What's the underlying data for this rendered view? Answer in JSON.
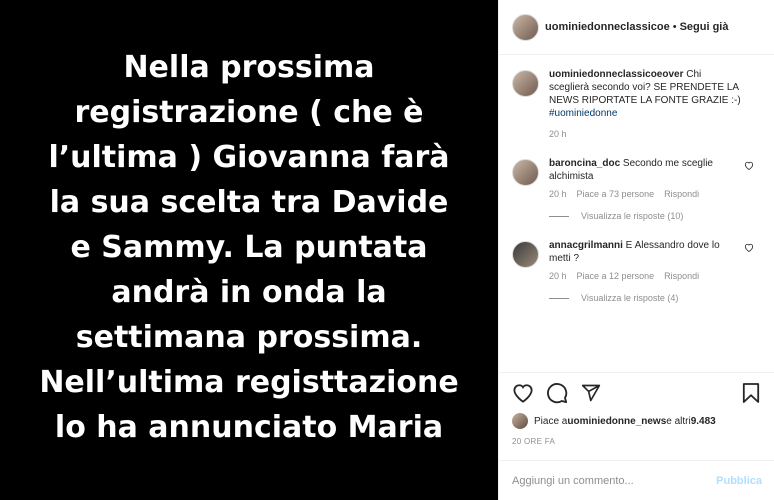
{
  "post": {
    "image_text": "Nella prossima\nregistrazione ( che è\nl’ultima ) Giovanna farà\nla sua scelta tra Davide\ne Sammy. La puntata\nandrà in onda la\nsettimana prossima.\nNell’ultima registtazione\nlo ha annunciato Maria"
  },
  "header": {
    "username": "uominiedonneclassicoe",
    "separator": "•",
    "follow_label": "Segui già"
  },
  "caption": {
    "username": "uominiedonneclassicoeover",
    "text": " Chi sceglierà secondo voi? SE PRENDETE LA NEWS RIPORTATE LA FONTE GRAZIE :-) ",
    "hashtag": "#uominiedonne",
    "time": "20 h"
  },
  "comments": [
    {
      "username": "baroncina_doc",
      "text": " Secondo me sceglie alchimista",
      "time": "20 h",
      "likes": "Piace a 73 persone",
      "reply_label": "Rispondi",
      "view_replies": "Visualizza le risposte (10)"
    },
    {
      "username": "annacgrilmanni",
      "text": " E Alessandro dove lo metti ?",
      "time": "20 h",
      "likes": "Piace a 12 persone",
      "reply_label": "Rispondi",
      "view_replies": "Visualizza le risposte (4)"
    }
  ],
  "likes": {
    "prefix": "Piace a ",
    "user": "uominiedonne_news",
    "middle": " e altri ",
    "count": "9.483"
  },
  "date": "20 ORE FA",
  "add_comment": {
    "placeholder": "Aggiungi un commento...",
    "publish_label": "Pubblica"
  },
  "icons": {
    "like": "heart-icon",
    "comment": "comment-icon",
    "share": "share-icon",
    "save": "bookmark-icon",
    "comment_like": "small-heart-icon"
  },
  "colors": {
    "link": "#00376b",
    "muted": "#8e8e8e",
    "publish_disabled": "#b2dffc"
  }
}
